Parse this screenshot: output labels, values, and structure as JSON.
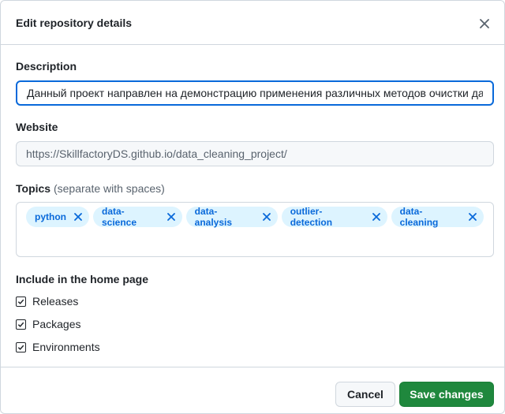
{
  "dialog": {
    "title": "Edit repository details",
    "close_icon": "close-icon"
  },
  "description": {
    "label": "Description",
    "value": "Данный проект направлен на демонстрацию применения различных методов очистки данных"
  },
  "website": {
    "label": "Website",
    "placeholder": "https://SkillfactoryDS.github.io/data_cleaning_project/"
  },
  "topics": {
    "label": "Topics",
    "hint": "(separate with spaces)",
    "items": [
      "python",
      "data-science",
      "data-analysis",
      "outlier-detection",
      "data-cleaning"
    ],
    "remove_icon": "x-icon"
  },
  "home_page": {
    "label": "Include in the home page",
    "options": [
      {
        "label": "Releases",
        "checked": true
      },
      {
        "label": "Packages",
        "checked": true
      },
      {
        "label": "Environments",
        "checked": true
      }
    ]
  },
  "footer": {
    "cancel_label": "Cancel",
    "save_label": "Save changes"
  },
  "colors": {
    "accent": "#0969da",
    "topic_bg": "#ddf4ff",
    "primary_button": "#1f883d"
  }
}
